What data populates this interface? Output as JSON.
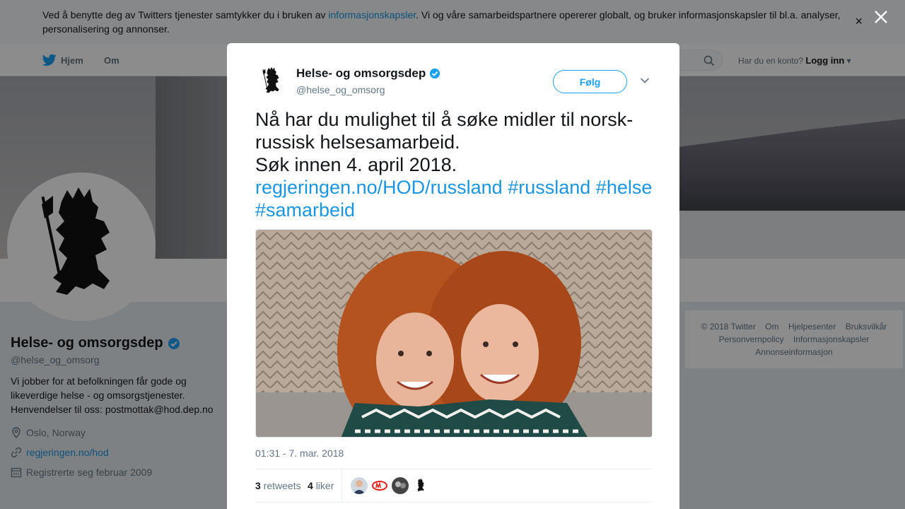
{
  "cookie": {
    "text_before": "Ved å benytte deg av Twitters tjenester samtykker du i bruken av ",
    "link": "informasjonskapsler",
    "text_after": ". Vi og våre samarbeidspartnere opererer globalt, og bruker informasjonskapsler til bl.a. analyser, personalisering og annonser.",
    "close": "×"
  },
  "nav": {
    "home": "Hjem",
    "about": "Om",
    "login_prompt": "Har du en konto?",
    "login": "Logg inn"
  },
  "profile": {
    "name": "Helse- og omsorgsdep",
    "handle": "@helse_og_omsorg",
    "bio": "Vi jobber for at befolkningen får gode og likeverdige helse - og omsorgstjenester. Henvendelser til oss: postmottak@hod.dep.no",
    "location": "Oslo, Norway",
    "website": "regjeringen.no/hod",
    "joined": "Registrerte seg februar 2009"
  },
  "footer": {
    "items": [
      "© 2018 Twitter",
      "Om",
      "Hjelpesenter",
      "Bruksvilkår",
      "Personvernpolicy",
      "Informasjonskapsler",
      "Annonseinformasjon"
    ]
  },
  "tweet": {
    "author_name": "Helse- og omsorgsdep",
    "author_handle": "@helse_og_omsorg",
    "follow_label": "Følg",
    "text_line1": "Nå har du mulighet til å søke midler til norsk-russisk helsesamarbeid.",
    "text_line2": "Søk innen 4. april 2018.",
    "link": "regjeringen.no/HOD/russland",
    "tag1": "#russland",
    "tag2": "#helse",
    "tag3": "#samarbeid",
    "timestamp": "01:31 - 7. mar. 2018",
    "retweets_count": "3",
    "retweets_label": "retweets",
    "likes_count": "4",
    "likes_label": "liker"
  },
  "colors": {
    "accent": "#1da1f2",
    "link": "#1b95e0",
    "verified": "#1da1f2"
  }
}
